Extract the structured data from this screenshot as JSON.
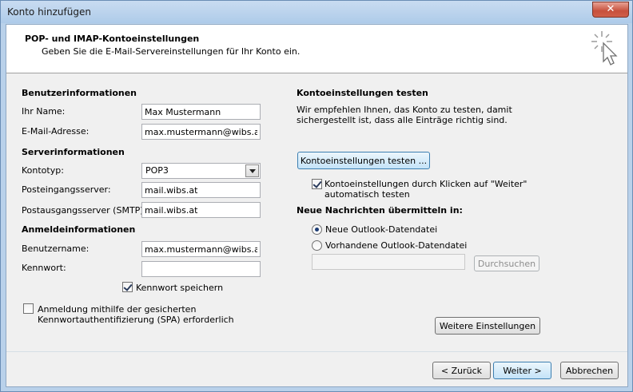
{
  "window": {
    "title": "Konto hinzufügen",
    "close_label": "✕"
  },
  "header": {
    "title": "POP- und IMAP-Kontoeinstellungen",
    "subtitle": "Geben Sie die E-Mail-Servereinstellungen für Ihr Konto ein."
  },
  "left": {
    "user_section": "Benutzerinformationen",
    "name_label": "Ihr Name:",
    "name_value": "Max Mustermann",
    "email_label": "E-Mail-Adresse:",
    "email_value": "max.mustermann@wibs.at",
    "server_section": "Serverinformationen",
    "account_type_label": "Kontotyp:",
    "account_type_value": "POP3",
    "incoming_label": "Posteingangsserver:",
    "incoming_value": "mail.wibs.at",
    "outgoing_label": "Postausgangsserver (SMTP):",
    "outgoing_value": "mail.wibs.at",
    "login_section": "Anmeldeinformationen",
    "username_label": "Benutzername:",
    "username_value": "max.mustermann@wibs.at",
    "password_label": "Kennwort:",
    "password_value": "",
    "save_password_label": "Kennwort speichern",
    "spa_label_line1": "Anmeldung mithilfe der gesicherten",
    "spa_label_line2": "Kennwortauthentifizierung (SPA) erforderlich"
  },
  "right": {
    "test_section": "Kontoeinstellungen testen",
    "test_desc_line1": "Wir empfehlen Ihnen, das Konto zu testen, damit",
    "test_desc_line2": "sichergestellt ist, dass alle Einträge richtig sind.",
    "test_button": "Kontoeinstellungen testen ...",
    "auto_test_line1": "Kontoeinstellungen durch Klicken auf \"Weiter\"",
    "auto_test_line2": "automatisch testen",
    "deliver_section": "Neue Nachrichten übermitteln in:",
    "radio_new": "Neue Outlook-Datendatei",
    "radio_existing": "Vorhandene Outlook-Datendatei",
    "existing_path": "",
    "browse_button": "Durchsuchen",
    "more_settings_button": "Weitere Einstellungen"
  },
  "footer": {
    "back_button": "< Zurück",
    "next_button": "Weiter >",
    "cancel_button": "Abbrechen"
  },
  "state": {
    "save_password_checked": true,
    "spa_checked": false,
    "auto_test_checked": true,
    "new_data_file_selected": true
  }
}
